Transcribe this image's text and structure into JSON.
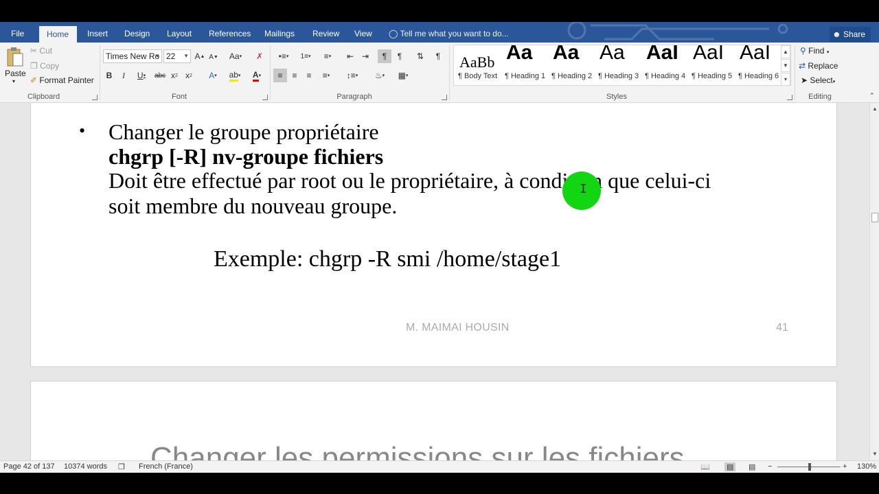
{
  "tabs": [
    "File",
    "Home",
    "Insert",
    "Design",
    "Layout",
    "References",
    "Mailings",
    "Review",
    "View"
  ],
  "tell_me": "Tell me what you want to do...",
  "share": "Share",
  "clipboard": {
    "paste": "Paste",
    "cut": "Cut",
    "copy": "Copy",
    "format_painter": "Format Painter",
    "label": "Clipboard"
  },
  "font": {
    "name": "Times New Ro",
    "size": "22",
    "label": "Font"
  },
  "paragraph": {
    "label": "Paragraph"
  },
  "styles": {
    "items": [
      {
        "preview": "AaBb",
        "name": "¶ Body Text"
      },
      {
        "preview": "Aa",
        "name": "¶ Heading 1"
      },
      {
        "preview": "Aa",
        "name": "¶ Heading 2"
      },
      {
        "preview": "Aa",
        "name": "¶ Heading 3"
      },
      {
        "preview": "AaI",
        "name": "¶ Heading 4"
      },
      {
        "preview": "AaI",
        "name": "¶ Heading 5"
      },
      {
        "preview": "AaI",
        "name": "¶ Heading 6"
      }
    ],
    "label": "Styles"
  },
  "editing": {
    "find": "Find",
    "replace": "Replace",
    "select": "Select",
    "label": "Editing"
  },
  "document": {
    "bullet": "•",
    "line1": "Changer le groupe propriétaire",
    "line2": "chgrp [-R] nv-groupe fichiers",
    "line3": "Doit être effectué par root ou le propriétaire, à condition que celui-ci",
    "line4": "soit membre du nouveau groupe.",
    "example": "Exemple: chgrp -R smi  /home/stage1",
    "footer_author": "M.   MAIMAI HOUSIN",
    "footer_page": "41",
    "page2_title": "Changer les permissions sur les fichiers"
  },
  "status": {
    "page": "Page 42 of 137",
    "words": "10374 words",
    "language": "French (France)",
    "zoom": "130%"
  },
  "colors": {
    "ribbon_blue": "#2b579a",
    "cursor_highlight": "#13d613"
  }
}
